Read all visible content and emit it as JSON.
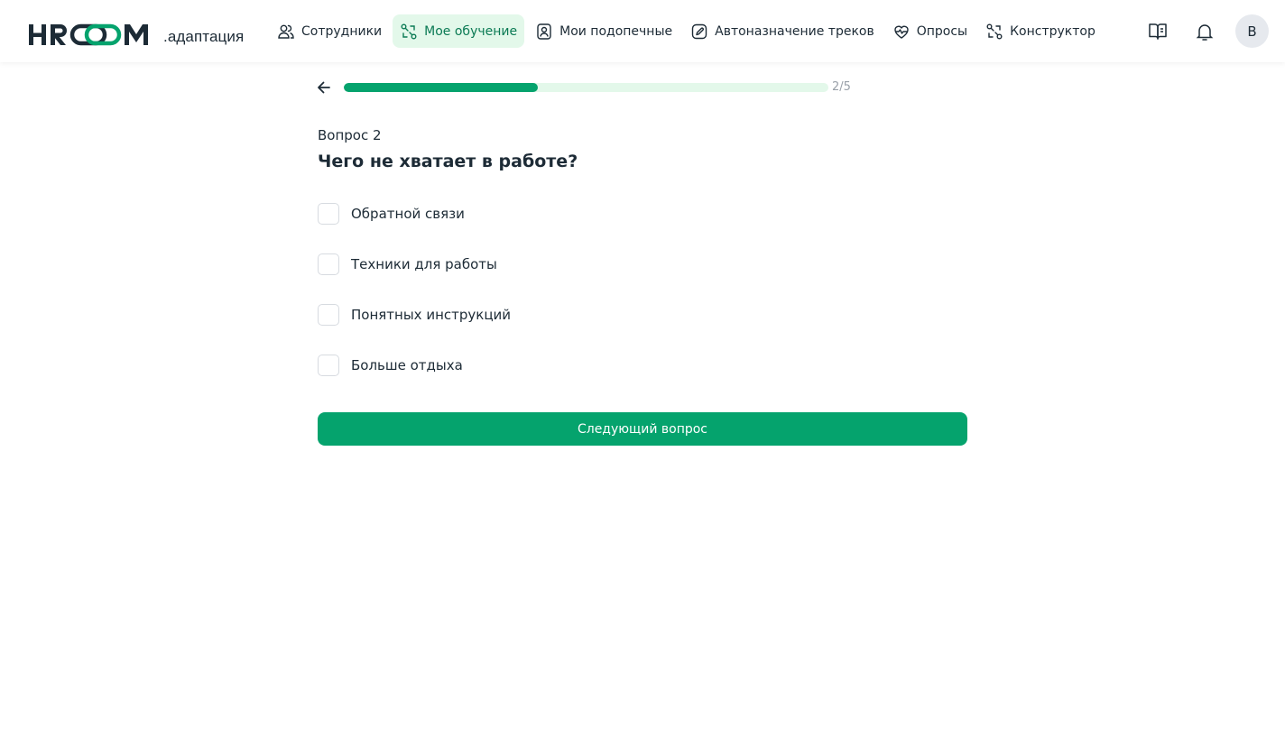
{
  "brand": {
    "logo_text": "HROOM",
    "logo_suffix": ".адаптация",
    "colors": {
      "dark": "#1d2b36",
      "accent": "#05a36d",
      "accent_light": "#e3f8ea"
    }
  },
  "nav": {
    "items": [
      {
        "label": "Сотрудники",
        "icon": "users-icon",
        "active": false
      },
      {
        "label": "Мое обучение",
        "icon": "route-icon",
        "active": true
      },
      {
        "label": "Мои подопечные",
        "icon": "person-badge-icon",
        "active": false
      },
      {
        "label": "Автоназначение треков",
        "icon": "pen-icon",
        "active": false
      },
      {
        "label": "Опросы",
        "icon": "heart-pulse-icon",
        "active": false
      },
      {
        "label": "Конструктор",
        "icon": "route-icon",
        "active": false
      }
    ]
  },
  "header_actions": {
    "book_icon": "book-icon",
    "bell_icon": "bell-icon",
    "avatar_initial": "В"
  },
  "progress": {
    "current": 2,
    "total": 5,
    "label": "2/5",
    "fill_fraction": 0.4
  },
  "question": {
    "number_label": "Вопрос 2",
    "title": "Чего не хватает в работе?",
    "options": [
      {
        "label": "Обратной связи",
        "checked": false
      },
      {
        "label": "Техники для работы",
        "checked": false
      },
      {
        "label": "Понятных инструкций",
        "checked": false
      },
      {
        "label": "Больше отдыха",
        "checked": false
      }
    ]
  },
  "actions": {
    "next_label": "Следующий вопрос"
  }
}
